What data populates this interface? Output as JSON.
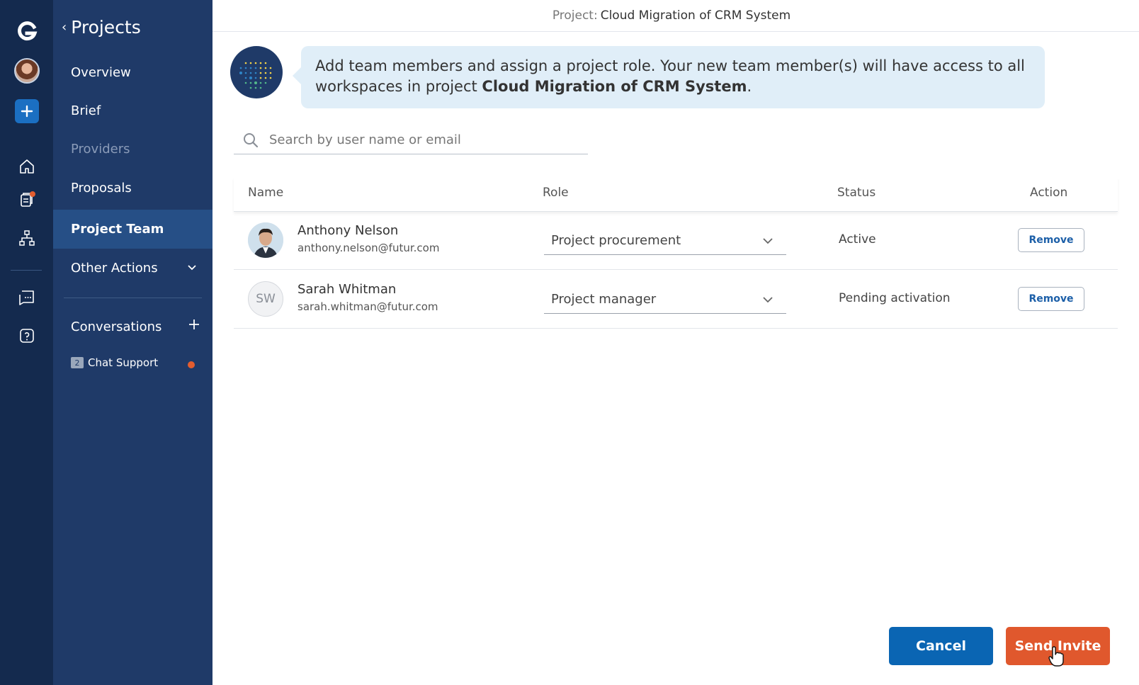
{
  "app": {
    "title": "Project Team",
    "colors": {
      "rail": "#142a4e",
      "nav": "#1f3a68",
      "active": "#264f86",
      "primary": "#0a65b3",
      "accent": "#e0582d",
      "info_bg": "#e0eef8"
    }
  },
  "rail": {
    "icons": [
      "g-logo-icon",
      "user-avatar",
      "plus-icon",
      "home-icon",
      "documents-icon",
      "org-chart-icon",
      "chat-icon",
      "help-icon"
    ]
  },
  "nav": {
    "back_label": "Projects",
    "items": [
      {
        "label": "Overview",
        "state": "normal"
      },
      {
        "label": "Brief",
        "state": "normal"
      },
      {
        "label": "Providers",
        "state": "disabled"
      },
      {
        "label": "Proposals",
        "state": "normal"
      },
      {
        "label": "Project Team",
        "state": "active"
      },
      {
        "label": "Other Actions",
        "state": "normal"
      }
    ],
    "conversations": {
      "title": "Conversations",
      "chat": {
        "badge": "2",
        "label": "Chat Support"
      }
    }
  },
  "header": {
    "project_label": "Project:",
    "project_name": "Cloud Migration of CRM System"
  },
  "info": {
    "text": "Add team members and assign a project role. Your new team member(s) will have access to all workspaces in project ",
    "project_name": "Cloud Migration of CRM System",
    "end": "."
  },
  "search": {
    "placeholder": "Search by user name or email"
  },
  "table": {
    "headers": {
      "name": "Name",
      "role": "Role",
      "status": "Status",
      "action": "Action"
    },
    "rows": [
      {
        "name": "Anthony Nelson",
        "email": "anthony.nelson@futur.com",
        "initials": "",
        "role": "Project procurement",
        "status": "Active",
        "action": "Remove"
      },
      {
        "name": "Sarah Whitman",
        "email": "sarah.whitman@futur.com",
        "initials": "SW",
        "role": "Project manager",
        "status": "Pending activation",
        "action": "Remove"
      }
    ]
  },
  "footer": {
    "cancel_label": "Cancel",
    "send_label": "Send Invite"
  }
}
